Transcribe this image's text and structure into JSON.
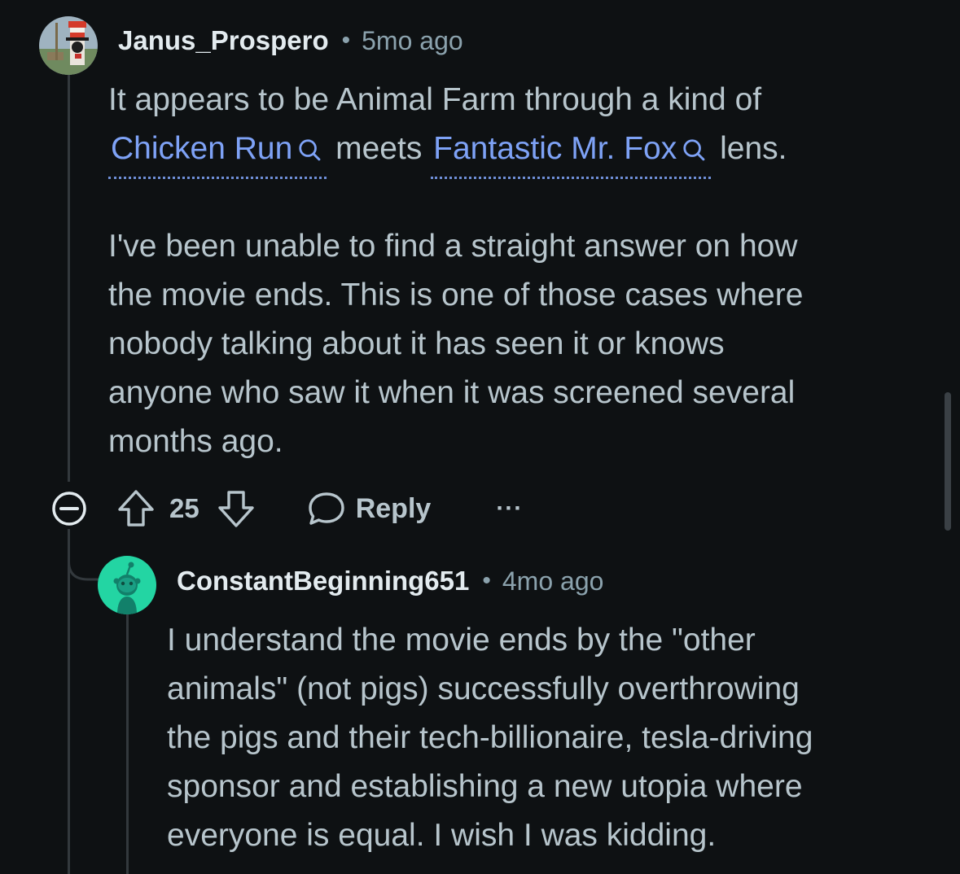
{
  "comment": {
    "author": "Janus_Prospero",
    "separator": "•",
    "time": "5mo ago",
    "line1": "It appears to be Animal Farm through a kind of",
    "link1": "Chicken Run",
    "between": "meets",
    "link2": "Fantastic Mr. Fox",
    "after": "lens.",
    "paragraph2": [
      "I've been unable to find a straight answer on how",
      "the movie ends. This is one of those cases where",
      "nobody talking about it has seen it or knows",
      "anyone who saw it when it was screened several",
      "months ago."
    ],
    "actions": {
      "score": "25",
      "reply_label": "Reply",
      "more_label": "···"
    }
  },
  "reply": {
    "author": "ConstantBeginning651",
    "separator": "•",
    "time": "4mo ago",
    "lines": [
      "I understand the movie ends by the \"other",
      "animals\" (not pigs) successfully overthrowing",
      "the pigs and their tech-billionaire, tesla-driving",
      "sponsor and establishing a new utopia where",
      "everyone is equal. I wish I was kidding."
    ]
  },
  "colors": {
    "background": "#0e1113",
    "link": "#7ea2f6",
    "reply_avatar": "#23d5a3"
  },
  "icons": [
    "collapse-icon",
    "upvote-icon",
    "downvote-icon",
    "reply-bubble-icon",
    "search-icon"
  ]
}
